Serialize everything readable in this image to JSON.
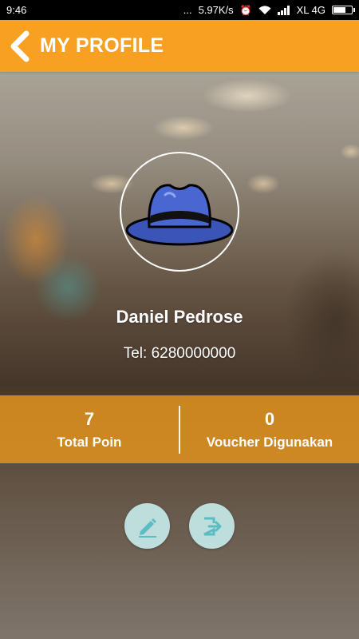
{
  "status_bar": {
    "time": "9:46",
    "dots": "...",
    "network_speed": "5.97K/s",
    "carrier": "XL 4G",
    "battery_level": 0.7
  },
  "app_bar": {
    "title": "MY PROFILE",
    "back_icon": "chevron-left-icon"
  },
  "profile": {
    "avatar_icon": "hat-icon",
    "name": "Daniel Pedrose",
    "tel_label": "Tel: ",
    "tel_value": "6280000000"
  },
  "stats": [
    {
      "value": "7",
      "label": "Total Poin"
    },
    {
      "value": "0",
      "label": "Voucher Digunakan"
    }
  ],
  "actions": {
    "edit_icon": "edit-icon",
    "logout_icon": "logout-icon"
  },
  "colors": {
    "accent": "#f7a021",
    "stats_bar": "#e6961e",
    "action_button": "#c8ecec",
    "action_icon": "#5bbcc4"
  }
}
